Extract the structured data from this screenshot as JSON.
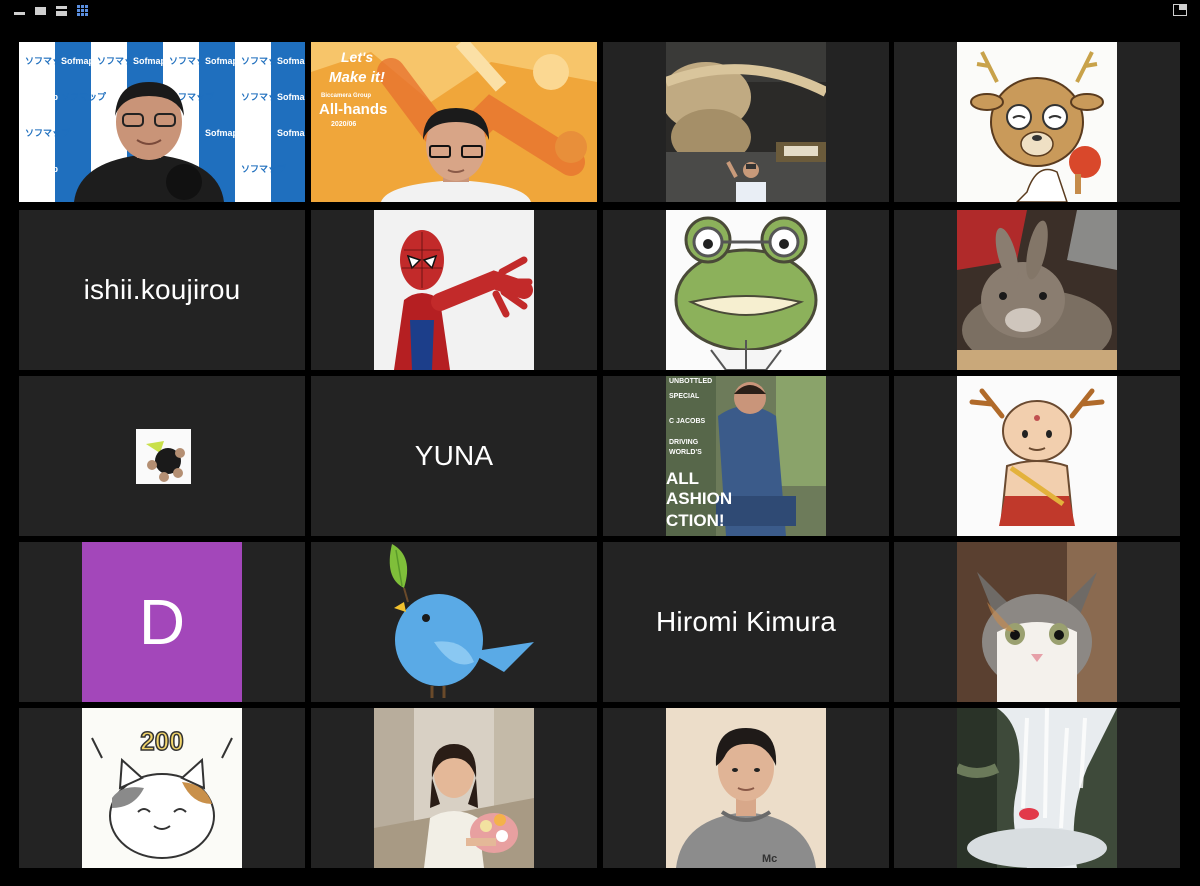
{
  "toolbar": {
    "buttons": [
      {
        "name": "minimize-icon"
      },
      {
        "name": "speaker-view-icon"
      },
      {
        "name": "thumbnail-view-icon"
      },
      {
        "name": "gallery-view-icon",
        "active": true
      },
      {
        "name": "exit-fullscreen-icon"
      }
    ]
  },
  "gallery": {
    "participants": [
      {
        "kind": "video",
        "scene": "sofmap backdrop",
        "active_speaker": true,
        "backdrop_text": [
          "ソフマップ",
          "Sofmap"
        ]
      },
      {
        "kind": "video",
        "scene": "all-hands backdrop",
        "backdrop_text": [
          "Let's",
          "Make it!",
          "Biccamera Group",
          "All-hands",
          "2020/06"
        ]
      },
      {
        "kind": "avatar",
        "scene": "shrine photo"
      },
      {
        "kind": "avatar",
        "scene": "deer with glasses"
      },
      {
        "kind": "name",
        "display_name": "ishii.koujirou"
      },
      {
        "kind": "avatar",
        "scene": "spider-man figure"
      },
      {
        "kind": "avatar",
        "scene": "frog with glasses"
      },
      {
        "kind": "avatar",
        "scene": "rabbit"
      },
      {
        "kind": "avatar",
        "scene": "small icon"
      },
      {
        "kind": "name",
        "display_name": "YUNA"
      },
      {
        "kind": "avatar",
        "scene": "magazine cover",
        "cover_text": [
          "UNBOTTLED",
          "SPECIAL",
          "C JACOBS",
          "DRIVING",
          "WORLD'S",
          "ALL",
          "ASHION",
          "CTION!"
        ]
      },
      {
        "kind": "avatar",
        "scene": "buddha with antlers"
      },
      {
        "kind": "letter",
        "letter": "D",
        "color": "#a347ba"
      },
      {
        "kind": "avatar",
        "scene": "blue bird"
      },
      {
        "kind": "name",
        "display_name": "Hiromi Kimura"
      },
      {
        "kind": "avatar",
        "scene": "kitten"
      },
      {
        "kind": "avatar",
        "scene": "cat 200",
        "caption": "200"
      },
      {
        "kind": "avatar",
        "scene": "woman with flowers"
      },
      {
        "kind": "avatar",
        "scene": "man in hoodie",
        "hoodie_text": "Mc"
      },
      {
        "kind": "avatar",
        "scene": "waterfall"
      }
    ]
  }
}
